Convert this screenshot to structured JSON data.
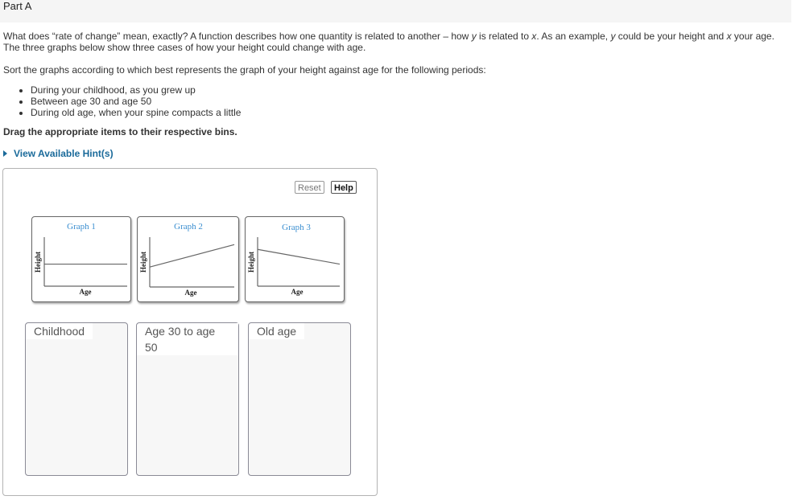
{
  "part": {
    "title": "Part A"
  },
  "intro": {
    "s1": "What does “rate of change” mean, exactly? A function describes how one quantity is related to another – how ",
    "y1": "y",
    "s2": " is related to ",
    "x1": "x",
    "s3": ". As an example, ",
    "y2": "y",
    "s4": " could be your height and ",
    "x2": "x",
    "s5": " your age. The three graphs below show three cases of how your height could change with age."
  },
  "sort_prompt": "Sort the graphs according to which best represents the graph of your height against age for the following periods:",
  "periods": [
    "During your childhood, as you grew up",
    "Between age 30 and age 50",
    "During old age, when your spine compacts a little"
  ],
  "drag_instruction": "Drag the appropriate items to their respective bins.",
  "hint": {
    "label": "View Available Hint(s)",
    "icon": "triangle-right-icon"
  },
  "toolbar": {
    "reset_label": "Reset",
    "help_label": "Help"
  },
  "graphs": [
    {
      "title": "Graph 1",
      "xlabel": "Age",
      "ylabel": "Height",
      "trend": "constant",
      "start": 0.45,
      "end": 0.45
    },
    {
      "title": "Graph 2",
      "xlabel": "Age",
      "ylabel": "Height",
      "trend": "increasing",
      "start": 0.4,
      "end": 0.85
    },
    {
      "title": "Graph 3",
      "xlabel": "Age",
      "ylabel": "Height",
      "trend": "decreasing",
      "start": 0.75,
      "end": 0.45
    }
  ],
  "bins": [
    {
      "label": "Childhood"
    },
    {
      "label": "Age 30 to age 50"
    },
    {
      "label": "Old age"
    }
  ],
  "colors": {
    "hint_link": "#1a6a9a",
    "graph_title": "#3a8ed0",
    "header_bg": "#f5f5f5",
    "bin_bg": "#f7f7f7"
  }
}
